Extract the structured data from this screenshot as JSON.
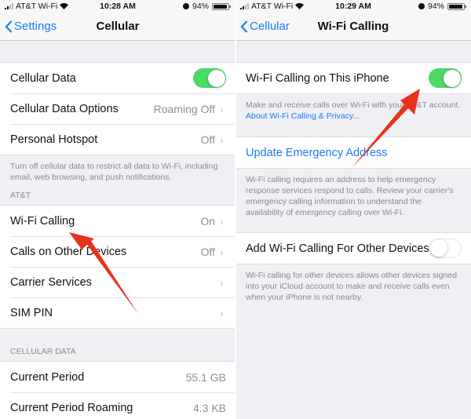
{
  "left_screen": {
    "status": {
      "carrier": "AT&T Wi-Fi",
      "time": "10:28 AM",
      "battery": "94%",
      "battery_level": 0.94
    },
    "nav": {
      "back_label": "Settings",
      "title": "Cellular"
    },
    "group1": [
      {
        "label": "Cellular Data",
        "toggle": true
      },
      {
        "label": "Cellular Data Options",
        "value": "Roaming Off"
      },
      {
        "label": "Personal Hotspot",
        "value": "Off"
      }
    ],
    "group1_footer": "Turn off cellular data to restrict all data to Wi-Fi, including email, web browsing, and push notifications.",
    "carrier_header": "AT&T",
    "group2": [
      {
        "label": "Wi-Fi Calling",
        "value": "On"
      },
      {
        "label": "Calls on Other Devices",
        "value": "Off"
      },
      {
        "label": "Carrier Services",
        "value": ""
      },
      {
        "label": "SIM PIN",
        "value": ""
      }
    ],
    "cellular_data_header": "Cellular Data",
    "group3": [
      {
        "label": "Current Period",
        "value": "55.1 GB"
      },
      {
        "label": "Current Period Roaming",
        "value": "4.3 KB"
      }
    ]
  },
  "right_screen": {
    "status": {
      "carrier": "AT&T Wi-Fi",
      "time": "10:29 AM",
      "battery": "94%",
      "battery_level": 0.94
    },
    "nav": {
      "back_label": "Cellular",
      "title": "Wi-Fi Calling"
    },
    "wifi_calling_row": {
      "label": "Wi-Fi Calling on This iPhone",
      "toggle": true
    },
    "wifi_calling_footer_text": "Make and receive calls over Wi-Fi with your AT&T account.",
    "wifi_calling_footer_link": "About Wi-Fi Calling & Privacy...",
    "emergency_row": {
      "label": "Update Emergency Address"
    },
    "emergency_footer": "Wi-Fi calling requires an address to help emergency response services respond to calls. Review your carrier's emergency calling information to understand the availability of emergency calling over Wi-Fi.",
    "other_devices_row": {
      "label": "Add Wi-Fi Calling For Other Devices",
      "toggle": false
    },
    "other_devices_footer": "Wi-Fi calling for other devices allows other devices signed into your iCloud account to make and receive calls even when your iPhone is not nearby."
  },
  "annotations": {
    "arrow_color": "#e8321c",
    "arrow_count": 2
  },
  "icons": {
    "chevron": "›",
    "back": "chevron-left-icon",
    "wifi": "wifi-icon",
    "alarm": "alarm-icon",
    "battery": "battery-icon",
    "signal": "signal-icon"
  }
}
